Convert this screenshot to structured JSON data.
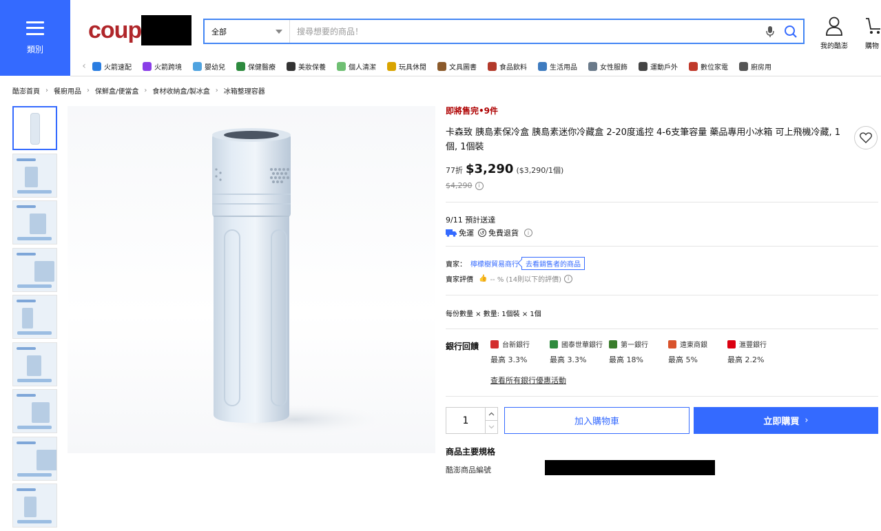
{
  "header": {
    "category_label": "類別",
    "logo_text": "coup",
    "search": {
      "scope": "全部",
      "placeholder": "搜尋想要的商品！"
    },
    "my_account_label": "我的酷澎",
    "cart_label": "購物"
  },
  "category_nav": [
    {
      "label": "火箭速配",
      "color": "#2a7de1"
    },
    {
      "label": "火箭跨境",
      "color": "#8a3ee8"
    },
    {
      "label": "嬰幼兒",
      "color": "#4fa3e0"
    },
    {
      "label": "保健醫療",
      "color": "#2d8a3e"
    },
    {
      "label": "美妝保養",
      "color": "#333333"
    },
    {
      "label": "個人清潔",
      "color": "#6fbf73"
    },
    {
      "label": "玩具休閒",
      "color": "#d9a400"
    },
    {
      "label": "文具圖書",
      "color": "#8b5a2b"
    },
    {
      "label": "食品飲料",
      "color": "#b33a2b"
    },
    {
      "label": "生活用品",
      "color": "#3e7bbf"
    },
    {
      "label": "女性服飾",
      "color": "#6a7a8a"
    },
    {
      "label": "運動戶外",
      "color": "#444444"
    },
    {
      "label": "數位家電",
      "color": "#c0392b"
    },
    {
      "label": "廚房用",
      "color": "#555555"
    }
  ],
  "breadcrumb": [
    "酷澎首頁",
    "餐廚用品",
    "保鮮盒/便當盒",
    "食材收納盒/製冰盒",
    "冰箱整理容器"
  ],
  "product": {
    "scarcity": "即將售完•9件",
    "title": "卡森致 胰島素保冷盒 胰島素迷你冷藏盒 2-20度遙控 4-6支筆容量 藥品專用小冰箱 可上飛機冷藏, 1個, 1個裝",
    "discount": "77折",
    "price": "$3,290",
    "unit_price": "($3,290/1個)",
    "original_price": "$4,290",
    "delivery_date": "9/11 預計送達",
    "free_shipping": "免運",
    "free_return": "免費退貨",
    "seller_label": "賣家：",
    "seller_name": "檸檬樹貿易商行",
    "seller_link": "去看銷售者的商品",
    "rating_label": "賣家評價",
    "rating_value": "-- % (14則以下的評價)",
    "quantity_note": "每份數量 × 數量: 1個裝 × 1個",
    "quantity": "1",
    "add_to_cart": "加入購物車",
    "buy_now": "立即購買"
  },
  "bank_promos": {
    "title": "銀行回饋",
    "banks": [
      {
        "name": "台新銀行",
        "rate": "最高 3.3%",
        "color": "#d32f2f"
      },
      {
        "name": "國泰世華銀行",
        "rate": "最高 3.3%",
        "color": "#2e8b3d"
      },
      {
        "name": "第一銀行",
        "rate": "最高 18%",
        "color": "#3a7d2c"
      },
      {
        "name": "遠東商銀",
        "rate": "最高 5%",
        "color": "#d9532c"
      },
      {
        "name": "滙豐銀行",
        "rate": "最高 2.2%",
        "color": "#db0011"
      }
    ],
    "link": "查看所有銀行優惠活動"
  },
  "specs": {
    "title": "商品主要規格",
    "row_label": "酷澎商品編號"
  }
}
